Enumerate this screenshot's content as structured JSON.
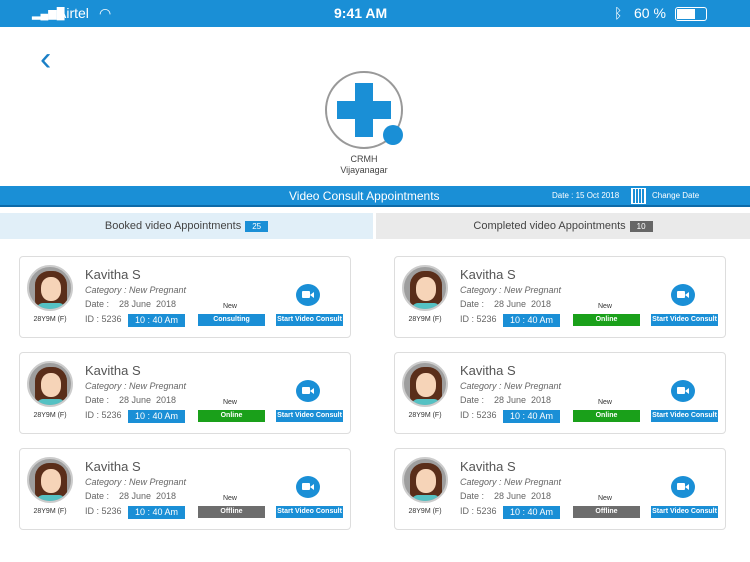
{
  "status_bar": {
    "carrier": "Airtel",
    "time": "9:41 AM",
    "battery": "60 %"
  },
  "org": {
    "name": "CRMH",
    "location": "Vijayanagar"
  },
  "header": {
    "title": "Video Consult  Appointments",
    "date": "Date : 15 Oct 2018",
    "change_date": "Change Date"
  },
  "tabs": [
    {
      "label": "Booked video Appointments",
      "count": "25",
      "color": "#1a8fd6"
    },
    {
      "label": "Completed  video Appointments",
      "count": "10",
      "color": "#666666"
    }
  ],
  "cards": [
    {
      "name": "Kavitha S",
      "category": "Category : New Pregnant",
      "date": "Date :    28 June  2018",
      "id": "ID : 5236",
      "time": "10 : 40 Am",
      "age": "28Y9M (F)",
      "tag": "New",
      "status": "Consulting",
      "status_color": "#1a8fd6",
      "action": "Start Video Consult"
    },
    {
      "name": "Kavitha S",
      "category": "Category : New Pregnant",
      "date": "Date :    28 June  2018",
      "id": "ID : 5236",
      "time": "10 : 40 Am",
      "age": "28Y9M (F)",
      "tag": "New",
      "status": "Online",
      "status_color": "#1aa01a",
      "action": "Start Video Consult"
    },
    {
      "name": "Kavitha S",
      "category": "Category : New Pregnant",
      "date": "Date :    28 June  2018",
      "id": "ID : 5236",
      "time": "10 : 40 Am",
      "age": "28Y9M (F)",
      "tag": "New",
      "status": "Offline",
      "status_color": "#6d6d6d",
      "action": "Start Video Consult"
    },
    {
      "name": "Kavitha S",
      "category": "Category : New Pregnant",
      "date": "Date :    28 June  2018",
      "id": "ID : 5236",
      "time": "10 : 40 Am",
      "age": "28Y9M (F)",
      "tag": "New",
      "status": "Online",
      "status_color": "#1aa01a",
      "action": "Start Video Consult"
    },
    {
      "name": "Kavitha S",
      "category": "Category : New Pregnant",
      "date": "Date :    28 June  2018",
      "id": "ID : 5236",
      "time": "10 : 40 Am",
      "age": "28Y9M (F)",
      "tag": "New",
      "status": "Online",
      "status_color": "#1aa01a",
      "action": "Start Video Consult"
    },
    {
      "name": "Kavitha S",
      "category": "Category : New Pregnant",
      "date": "Date :    28 June  2018",
      "id": "ID : 5236",
      "time": "10 : 40 Am",
      "age": "28Y9M (F)",
      "tag": "New",
      "status": "Offline",
      "status_color": "#6d6d6d",
      "action": "Start Video Consult"
    }
  ]
}
